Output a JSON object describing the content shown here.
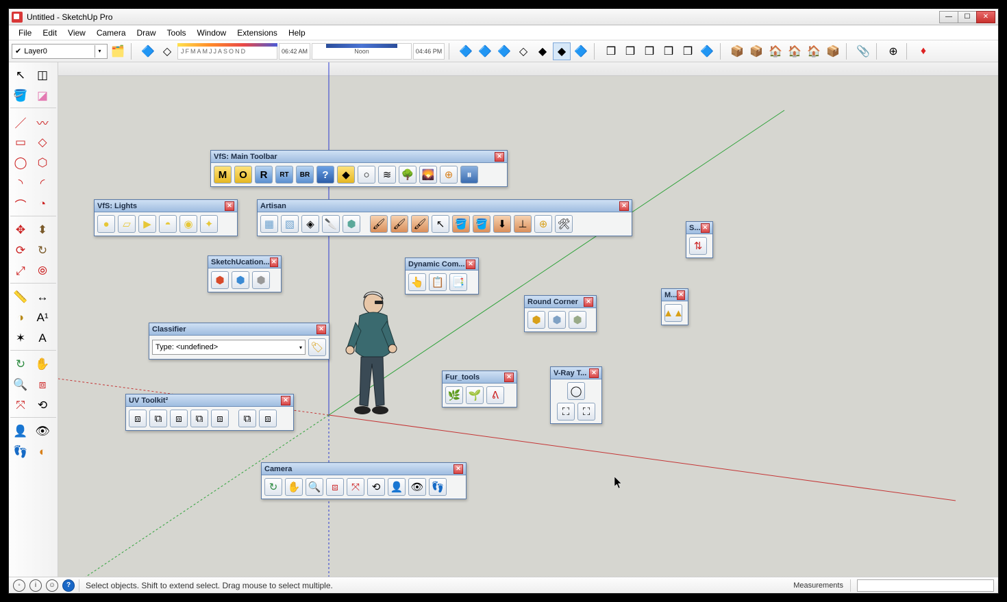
{
  "window": {
    "title": "Untitled - SketchUp Pro"
  },
  "menu": {
    "items": [
      "File",
      "Edit",
      "View",
      "Camera",
      "Draw",
      "Tools",
      "Window",
      "Extensions",
      "Help"
    ]
  },
  "toolbar": {
    "layer_combo_value": "Layer0",
    "months": [
      "J",
      "F",
      "M",
      "A",
      "M",
      "J",
      "J",
      "A",
      "S",
      "O",
      "N",
      "D"
    ],
    "time_left": "06:42 AM",
    "time_mid": "Noon",
    "time_right": "04:46 PM"
  },
  "panels": {
    "vfs_main": {
      "title": "VfS: Main Toolbar"
    },
    "vfs_lights": {
      "title": "VfS: Lights"
    },
    "artisan": {
      "title": "Artisan"
    },
    "sketchucation": {
      "title": "SketchUcation..."
    },
    "dynamic": {
      "title": "Dynamic Com..."
    },
    "classifier": {
      "title": "Classifier",
      "type_value": "Type: <undefined>"
    },
    "roundcorner": {
      "title": "Round Corner"
    },
    "short_s": {
      "title": "S..."
    },
    "short_m": {
      "title": "M..."
    },
    "uv": {
      "title": "UV Toolkit²"
    },
    "fur": {
      "title": "Fur_tools"
    },
    "vray": {
      "title": "V-Ray T..."
    },
    "camera": {
      "title": "Camera"
    }
  },
  "status": {
    "hint": "Select objects. Shift to extend select. Drag mouse to select multiple.",
    "measurements_label": "Measurements"
  }
}
